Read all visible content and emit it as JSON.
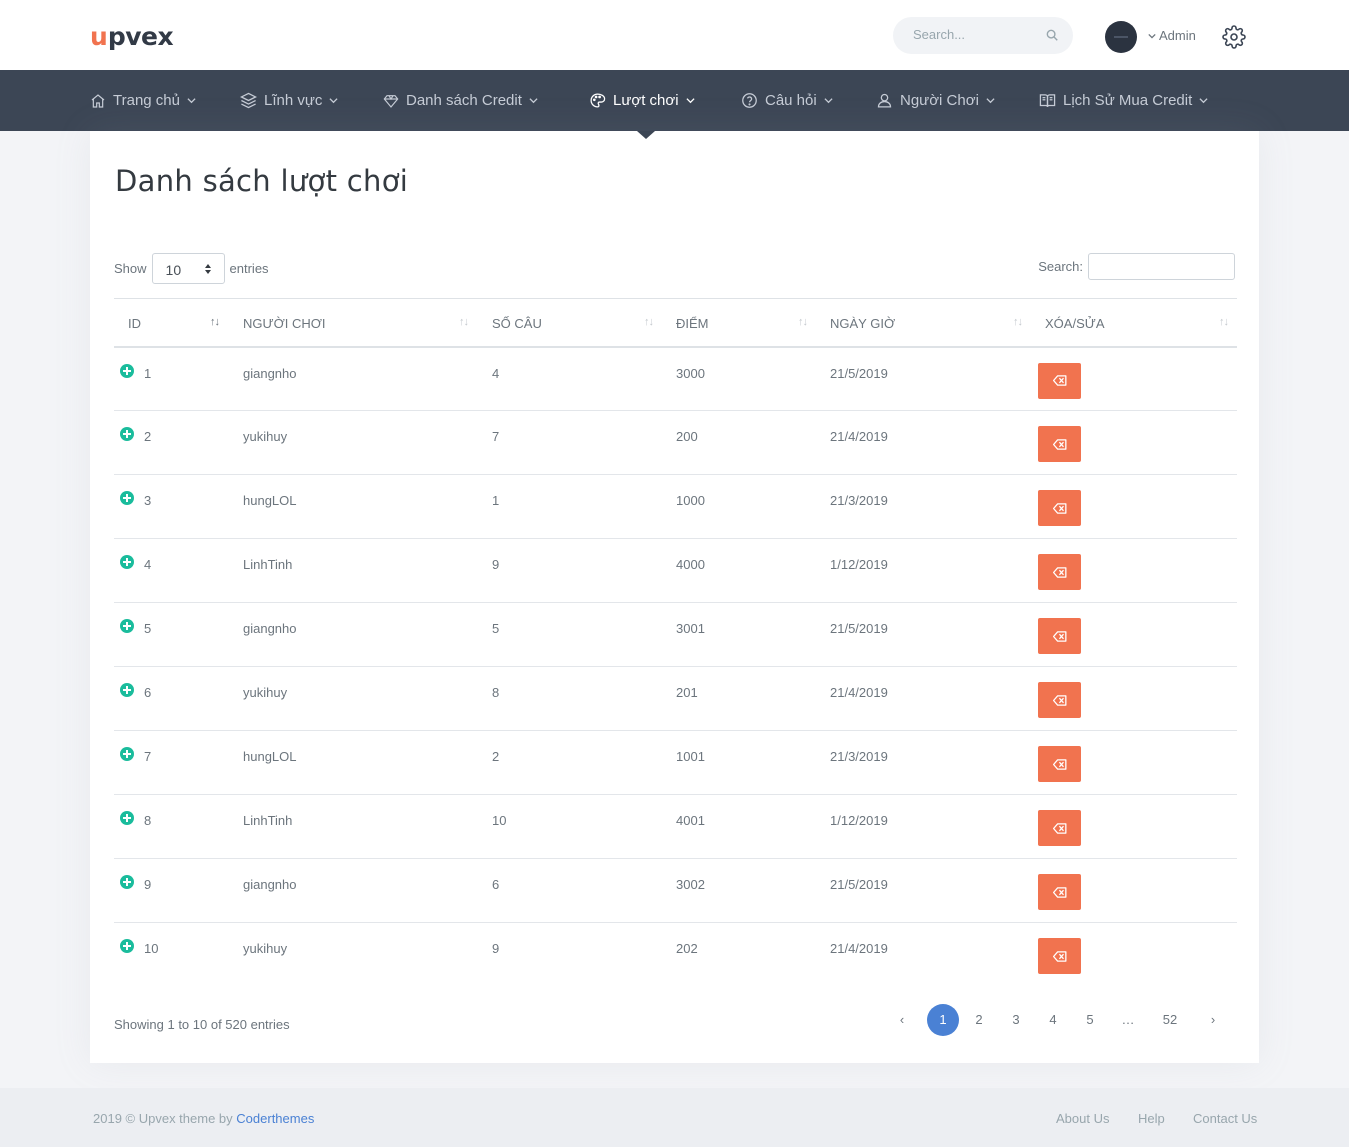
{
  "brand": {
    "part1": "u",
    "part2": "pvex",
    "accent": "#f1734f"
  },
  "topbar": {
    "search_placeholder": "Search...",
    "user_label": "Admin"
  },
  "nav": {
    "items": [
      {
        "label": "Trang chủ",
        "icon": "home-icon"
      },
      {
        "label": "Lĩnh vực",
        "icon": "layers-icon"
      },
      {
        "label": "Danh sách Credit",
        "icon": "diamond-icon"
      },
      {
        "label": "Lượt chơi",
        "icon": "palette-icon",
        "active": true
      },
      {
        "label": "Câu hỏi",
        "icon": "help-circle-icon"
      },
      {
        "label": "Người Chơi",
        "icon": "user-icon"
      },
      {
        "label": "Lịch Sử Mua Credit",
        "icon": "book-icon"
      }
    ]
  },
  "page": {
    "title": "Danh sách lượt chơi"
  },
  "table_controls": {
    "show_label": "Show",
    "entries_label": "entries",
    "page_length": "10",
    "search_label": "Search:"
  },
  "table": {
    "columns": [
      "ID",
      "NGƯỜI CHƠI",
      "SỐ CÂU",
      "ĐIỂM",
      "NGÀY GIỜ",
      "XÓA/SỬA"
    ],
    "rows": [
      [
        "1",
        "giangnho",
        "4",
        "3000",
        "21/5/2019"
      ],
      [
        "2",
        "yukihuy",
        "7",
        "200",
        "21/4/2019"
      ],
      [
        "3",
        "hungLOL",
        "1",
        "1000",
        "21/3/2019"
      ],
      [
        "4",
        "LinhTinh",
        "9",
        "4000",
        "1/12/2019"
      ],
      [
        "5",
        "giangnho",
        "5",
        "3001",
        "21/5/2019"
      ],
      [
        "6",
        "yukihuy",
        "8",
        "201",
        "21/4/2019"
      ],
      [
        "7",
        "hungLOL",
        "2",
        "1001",
        "21/3/2019"
      ],
      [
        "8",
        "LinhTinh",
        "10",
        "4001",
        "1/12/2019"
      ],
      [
        "9",
        "giangnho",
        "6",
        "3002",
        "21/5/2019"
      ],
      [
        "10",
        "yukihuy",
        "9",
        "202",
        "21/4/2019"
      ]
    ],
    "delete_button_color": "#f1734f",
    "expand_icon_color": "#1abc9c"
  },
  "pagination": {
    "info": "Showing 1 to 10 of 520 entries",
    "prev": "‹",
    "next": "›",
    "pages": [
      "1",
      "2",
      "3",
      "4",
      "5",
      "…",
      "52"
    ],
    "current": "1",
    "active_color": "#4a81d4"
  },
  "footer": {
    "copyright": "2019 © Upvex theme by ",
    "credit_link": "Coderthemes",
    "links": [
      "About Us",
      "Help",
      "Contact Us"
    ]
  }
}
